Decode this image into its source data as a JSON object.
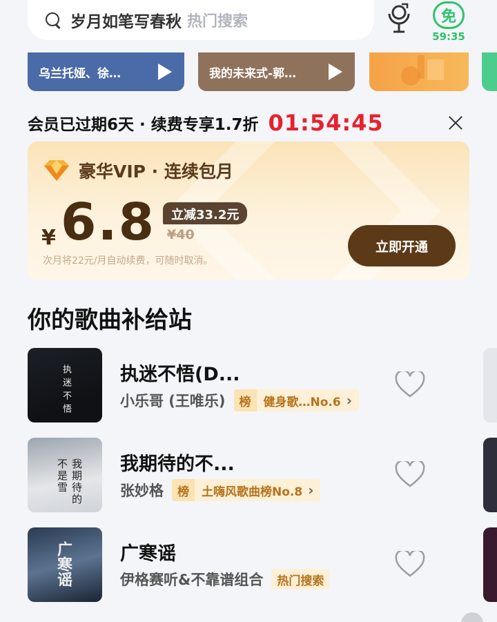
{
  "search": {
    "query": "岁月如笔写春秋",
    "hint": "热门搜索"
  },
  "free_badge": {
    "label": "免",
    "time": "59:35"
  },
  "banners": [
    {
      "title": "乌兰托娅、徐…"
    },
    {
      "title": "我的未来式-郭…"
    }
  ],
  "promo": {
    "text": "会员已过期6天 · 续费专享1.7折",
    "countdown": "01:54:45"
  },
  "vip": {
    "title": "豪华VIP · 连续包月",
    "currency": "¥",
    "price": "6.8",
    "discount": "立减33.2元",
    "original": "¥40",
    "note": "次月将22元/月自动续费，可随时取消。",
    "button": "立即开通"
  },
  "section_title": "你的歌曲补给站",
  "songs": [
    {
      "title": "执迷不悟(D...",
      "artist": "小乐哥 (王唯乐)",
      "tag_icon": "榜",
      "tag": "健身歌…No.6",
      "chevron": "›"
    },
    {
      "title": "我期待的不...",
      "artist": "张妙格",
      "tag_icon": "榜",
      "tag": "土嗨风歌曲榜No.8",
      "chevron": "›"
    },
    {
      "title": "广寒谣",
      "artist": "伊格赛听&不靠谱组合",
      "tag": "热门搜索"
    }
  ],
  "covers": {
    "c1": "执迷不悟",
    "c2": "我期待的不是雪",
    "c3": "广寒谣"
  },
  "colors": {
    "accent_green": "#2cc36b",
    "countdown_red": "#e8202e",
    "vip_brown": "#5c3a17"
  }
}
